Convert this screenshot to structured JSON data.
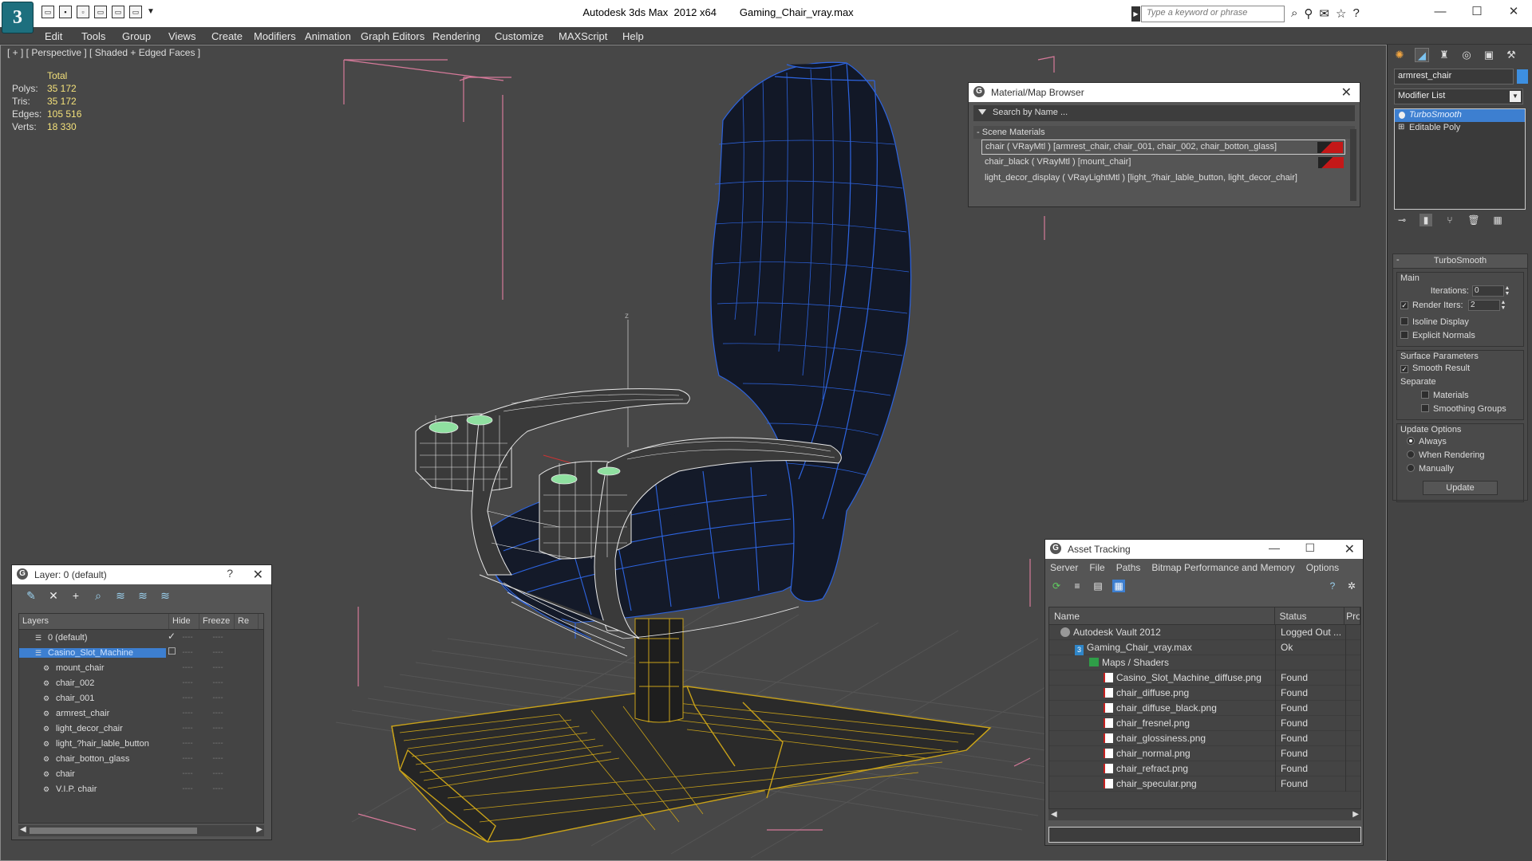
{
  "app": {
    "logo": "3",
    "window_title": "Autodesk 3ds Max  2012 x64        Gaming_Chair_vray.max",
    "search_placeholder": "Type a keyword or phrase",
    "quick_access": [
      "open",
      "save",
      "undo",
      "redo",
      "hold",
      "fetch"
    ],
    "window_controls": {
      "minimize": "—",
      "maximize": "☐",
      "close": "✕"
    }
  },
  "menu": [
    "Edit",
    "Tools",
    "Group",
    "Views",
    "Create",
    "Modifiers",
    "Animation",
    "Graph Editors",
    "Rendering",
    "Customize",
    "MAXScript",
    "Help"
  ],
  "viewport": {
    "label": "[ + ] [ Perspective ] [ Shaded + Edged Faces ]",
    "stats": {
      "total_label": "Total",
      "rows": [
        {
          "k": "Polys:",
          "v": "35 172"
        },
        {
          "k": "Tris:",
          "v": "35 172"
        },
        {
          "k": "Edges:",
          "v": "105 516"
        },
        {
          "k": "Verts:",
          "v": "18 330"
        }
      ]
    },
    "axis_label": "z",
    "colors": {
      "wire_white": "#ffffff",
      "wire_blue": "#2d64e0",
      "wire_gold": "#c9a219",
      "bbox": "#d67a9a",
      "grid": "#5a5a5a"
    }
  },
  "material_browser": {
    "title": "Material/Map Browser",
    "search_placeholder": "Search by Name ...",
    "section": "Scene Materials",
    "items": [
      "chair  ( VRayMtl )  [armrest_chair, chair_001, chair_002, chair_botton_glass]",
      "chair_black  ( VRayMtl )  [mount_chair]",
      "light_decor_display  ( VRayLightMtl )  [light_?hair_lable_button, light_decor_chair]"
    ]
  },
  "layer_panel": {
    "title": "Layer: 0 (default)",
    "help": "?",
    "columns": [
      "Layers",
      "Hide",
      "Freeze",
      "Re"
    ],
    "rows": [
      {
        "name": "0 (default)",
        "level": 1,
        "type": "layer",
        "check": "✓"
      },
      {
        "name": "Casino_Slot_Machine",
        "level": 1,
        "type": "layer",
        "selected": true
      },
      {
        "name": "mount_chair",
        "level": 2,
        "type": "object"
      },
      {
        "name": "chair_002",
        "level": 2,
        "type": "object"
      },
      {
        "name": "chair_001",
        "level": 2,
        "type": "object"
      },
      {
        "name": "armrest_chair",
        "level": 2,
        "type": "object"
      },
      {
        "name": "light_decor_chair",
        "level": 2,
        "type": "object"
      },
      {
        "name": "light_?hair_lable_button",
        "level": 2,
        "type": "object"
      },
      {
        "name": "chair_botton_glass",
        "level": 2,
        "type": "object"
      },
      {
        "name": "chair",
        "level": 2,
        "type": "object"
      },
      {
        "name": "V.I.P. chair",
        "level": 2,
        "type": "object"
      }
    ],
    "dash": "----"
  },
  "asset_tracking": {
    "title": "Asset Tracking",
    "menu": [
      "Server",
      "File",
      "Paths",
      "Bitmap Performance and Memory",
      "Options"
    ],
    "columns": [
      "Name",
      "Status",
      "Pro"
    ],
    "rows": [
      {
        "name": "Autodesk Vault 2012",
        "status": "Logged Out ...",
        "indent": 1,
        "icon": "vault"
      },
      {
        "name": "Gaming_Chair_vray.max",
        "status": "Ok",
        "indent": 2,
        "icon": "file"
      },
      {
        "name": "Maps / Shaders",
        "status": "",
        "indent": 3,
        "icon": "folder"
      },
      {
        "name": "Casino_Slot_Machine_diffuse.png",
        "status": "Found",
        "indent": 4,
        "icon": "png"
      },
      {
        "name": "chair_diffuse.png",
        "status": "Found",
        "indent": 4,
        "icon": "png"
      },
      {
        "name": "chair_diffuse_black.png",
        "status": "Found",
        "indent": 4,
        "icon": "png"
      },
      {
        "name": "chair_fresnel.png",
        "status": "Found",
        "indent": 4,
        "icon": "png"
      },
      {
        "name": "chair_glossiness.png",
        "status": "Found",
        "indent": 4,
        "icon": "png"
      },
      {
        "name": "chair_normal.png",
        "status": "Found",
        "indent": 4,
        "icon": "png"
      },
      {
        "name": "chair_refract.png",
        "status": "Found",
        "indent": 4,
        "icon": "png"
      },
      {
        "name": "chair_specular.png",
        "status": "Found",
        "indent": 4,
        "icon": "png"
      }
    ]
  },
  "command_panel": {
    "object_name": "armrest_chair",
    "object_color": "#3d8fe0",
    "modifier_list": "Modifier List",
    "stack": [
      {
        "name": "TurboSmooth",
        "selected": true
      },
      {
        "name": "Editable Poly",
        "selected": false
      }
    ],
    "rollout": {
      "title": "TurboSmooth",
      "main_label": "Main",
      "iterations_label": "Iterations:",
      "iterations_value": "0",
      "render_iters_label": "Render Iters:",
      "render_iters_value": "2",
      "render_iters_checked": true,
      "isoline_label": "Isoline Display",
      "explicit_normals_label": "Explicit Normals",
      "surface_label": "Surface Parameters",
      "smooth_result_label": "Smooth Result",
      "separate_label": "Separate",
      "materials_label": "Materials",
      "smoothing_groups_label": "Smoothing Groups",
      "update_options_label": "Update Options",
      "always_label": "Always",
      "when_rendering_label": "When Rendering",
      "manually_label": "Manually",
      "update_button": "Update"
    }
  }
}
